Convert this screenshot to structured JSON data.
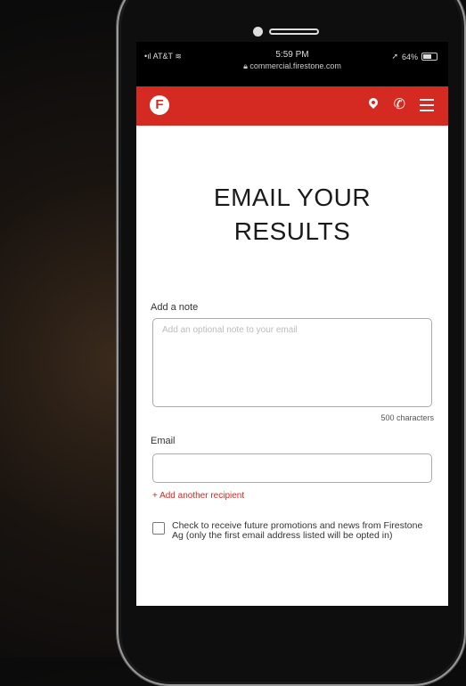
{
  "status_bar": {
    "carrier": "AT&T",
    "time": "5:59 PM",
    "url": "commercial.firestone.com",
    "battery": "64%"
  },
  "nav": {
    "logo_letter": "F"
  },
  "page": {
    "title_line1": "EMAIL YOUR",
    "title_line2": "RESULTS"
  },
  "form": {
    "note_label": "Add a note",
    "note_placeholder": "Add an optional note to your email",
    "char_count": "500 characters",
    "email_label": "Email",
    "email_value": "",
    "add_recipient": "+ Add another recipient",
    "promo_text": "Check to receive future promotions and news from Firestone Ag (only the first email address listed will be opted in)"
  },
  "colors": {
    "brand_red": "#d42a22"
  }
}
